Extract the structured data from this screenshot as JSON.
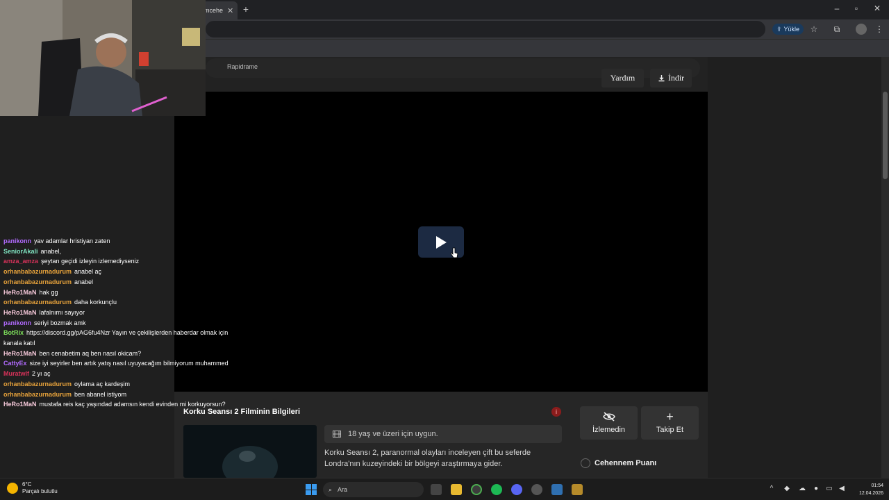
{
  "browser": {
    "tab_label": "mcehe",
    "upload_label": "Yükle"
  },
  "page": {
    "search_text": "Rapidrame",
    "player": {
      "help_label": "Yardım",
      "download_label": "İndir"
    },
    "info": {
      "title": "Korku Seansı 2 Filminin Bilgileri",
      "badge": "i",
      "age_rating": "18 yaş ve üzeri için uygun.",
      "description": "Korku Seansı 2, paranormal olayları inceleyen çift bu seferde Londra'nın kuzeyindeki bir bölgeyi araştırmaya gider.",
      "watch_status_label": "İzlemedin",
      "follow_label": "Takip Et",
      "score_label": "Cehennem Puanı"
    }
  },
  "chat": [
    {
      "user": "panikonn",
      "text": "yav adamlar hristiyan zaten",
      "color": "#b26bff"
    },
    {
      "user": "SeniorAkali",
      "text": "anabel,",
      "color": "#7fe3c0"
    },
    {
      "user": "amza_amza",
      "text": "şeytan geçidi izleyin izlemediyseniz",
      "color": "#d8325a"
    },
    {
      "user": "orhanbabazurnadurum",
      "text": "anabel aç",
      "color": "#e8a33b"
    },
    {
      "user": "orhanbabazurnadurum",
      "text": "anabel",
      "color": "#e8a33b"
    },
    {
      "user": "HeRo1MaN",
      "text": "hak gg",
      "color": "#f4c7d8"
    },
    {
      "user": "orhanbabazurnadurum",
      "text": "daha korkunçlu",
      "color": "#e8a33b"
    },
    {
      "user": "HeRo1MaN",
      "text": "lafalnımı sayıyor",
      "color": "#f4c7d8"
    },
    {
      "user": "panikonn",
      "text": "seriyi bozmak amk",
      "color": "#b26bff"
    },
    {
      "user": "BotRix",
      "text": "https://discord.gg/pAG6fu4Nzr Yayın ve çekilişlerden haberdar olmak için kanala katıl",
      "color": "#7ee05b"
    },
    {
      "user": "HeRo1MaN",
      "text": "ben cenabetim aq ben nasıl okicam?",
      "color": "#f4c7d8"
    },
    {
      "user": "CattyEx",
      "text": "size iyi seyirler ben artık yatış nasıl uyuyacağım bilmiyorum muhammed",
      "color": "#b26bff"
    },
    {
      "user": "Muratwlf",
      "text": "2 yı aç",
      "color": "#d8325a"
    },
    {
      "user": "orhanbabazurnadurum",
      "text": "oylama aç kardeşim",
      "color": "#e8a33b"
    },
    {
      "user": "orhanbabazurnadurum",
      "text": "ben abanel istiyom",
      "color": "#e8a33b"
    },
    {
      "user": "HeRo1MaN",
      "text": "mustafa reis kaç yaşındad adamsın kendi evinden mi korkuyorsun?",
      "color": "#f4c7d8"
    }
  ],
  "taskbar": {
    "weather_temp": "6°C",
    "weather_desc": "Parçalı bulutlu",
    "search_label": "Ara",
    "time": "01:54",
    "date": "12.04.2026"
  }
}
